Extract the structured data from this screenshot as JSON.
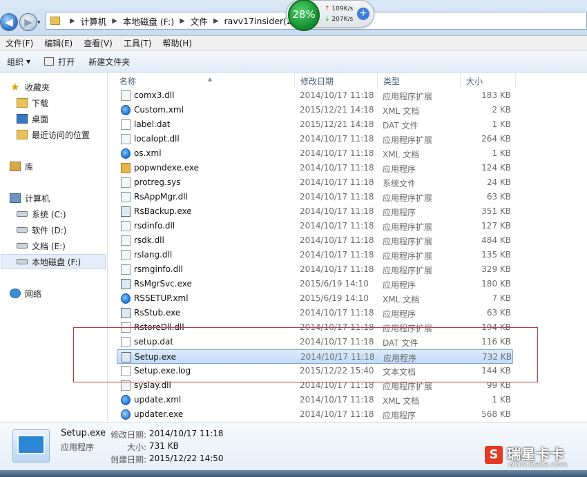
{
  "address_bar": {
    "recent_arrow": "▾",
    "path": [
      "计算机",
      "本地磁盘 (F:)",
      "文件",
      "ravv17insider(2)"
    ]
  },
  "net_widget": {
    "percent": "28%",
    "up": "109K/s",
    "down": "207K/s"
  },
  "menu": [
    "文件(F)",
    "编辑(E)",
    "查看(V)",
    "工具(T)",
    "帮助(H)"
  ],
  "toolbar": {
    "organize": "组织",
    "open": "打开",
    "new_folder": "新建文件夹"
  },
  "sidebar": {
    "favorites": "收藏夹",
    "downloads": "下载",
    "desktop": "桌面",
    "recent_places": "最近访问的位置",
    "libraries": "库",
    "computer": "计算机",
    "drive_c": "系统 (C:)",
    "drive_d": "软件 (D:)",
    "drive_e": "文档 (E:)",
    "drive_f": "本地磁盘 (F:)",
    "network": "网络"
  },
  "columns": {
    "name": "名称",
    "date": "修改日期",
    "type": "类型",
    "size": "大小"
  },
  "files": [
    {
      "name": "comx3.dll",
      "date": "2014/10/17 11:18",
      "type": "应用程序扩展",
      "size": "183 KB",
      "icon": "dll-icon"
    },
    {
      "name": "Custom.xml",
      "date": "2015/12/21 14:18",
      "type": "XML 文档",
      "size": "2 KB",
      "icon": "xml-icon"
    },
    {
      "name": "label.dat",
      "date": "2015/12/21 14:18",
      "type": "DAT 文件",
      "size": "1 KB",
      "icon": "dat-icon"
    },
    {
      "name": "localopt.dll",
      "date": "2014/10/17 11:18",
      "type": "应用程序扩展",
      "size": "264 KB",
      "icon": "dll-icon"
    },
    {
      "name": "os.xml",
      "date": "2014/10/17 11:18",
      "type": "XML 文档",
      "size": "1 KB",
      "icon": "xml-icon"
    },
    {
      "name": "popwndexe.exe",
      "date": "2014/10/17 11:18",
      "type": "应用程序",
      "size": "124 KB",
      "icon": "box-icon"
    },
    {
      "name": "protreg.sys",
      "date": "2014/10/17 11:18",
      "type": "系统文件",
      "size": "24 KB",
      "icon": "dll-icon"
    },
    {
      "name": "RsAppMgr.dll",
      "date": "2014/10/17 11:18",
      "type": "应用程序扩展",
      "size": "63 KB",
      "icon": "dll-icon"
    },
    {
      "name": "RsBackup.exe",
      "date": "2014/10/17 11:18",
      "type": "应用程序",
      "size": "351 KB",
      "icon": "exe-icon"
    },
    {
      "name": "rsdinfo.dll",
      "date": "2014/10/17 11:18",
      "type": "应用程序扩展",
      "size": "127 KB",
      "icon": "dll-icon"
    },
    {
      "name": "rsdk.dll",
      "date": "2014/10/17 11:18",
      "type": "应用程序扩展",
      "size": "484 KB",
      "icon": "dll-icon"
    },
    {
      "name": "rslang.dll",
      "date": "2014/10/17 11:18",
      "type": "应用程序扩展",
      "size": "135 KB",
      "icon": "dll-icon"
    },
    {
      "name": "rsmginfo.dll",
      "date": "2014/10/17 11:18",
      "type": "应用程序扩展",
      "size": "329 KB",
      "icon": "dll-icon"
    },
    {
      "name": "RsMgrSvc.exe",
      "date": "2015/6/19 14:10",
      "type": "应用程序",
      "size": "180 KB",
      "icon": "exe-icon"
    },
    {
      "name": "RSSETUP.xml",
      "date": "2015/6/19 14:10",
      "type": "XML 文档",
      "size": "7 KB",
      "icon": "xml-icon"
    },
    {
      "name": "RsStub.exe",
      "date": "2014/10/17 11:18",
      "type": "应用程序",
      "size": "63 KB",
      "icon": "exe-icon"
    },
    {
      "name": "RstoreDll.dll",
      "date": "2014/10/17 11:18",
      "type": "应用程序扩展",
      "size": "194 KB",
      "icon": "dll-icon"
    },
    {
      "name": "setup.dat",
      "date": "2014/10/17 11:18",
      "type": "DAT 文件",
      "size": "116 KB",
      "icon": "dat-icon"
    },
    {
      "name": "Setup.exe",
      "date": "2014/10/17 11:18",
      "type": "应用程序",
      "size": "732 KB",
      "icon": "exe-icon",
      "selected": true
    },
    {
      "name": "Setup.exe.log",
      "date": "2015/12/22 15:40",
      "type": "文本文档",
      "size": "144 KB",
      "icon": "log-icon"
    },
    {
      "name": "syslay.dll",
      "date": "2014/10/17 11:18",
      "type": "应用程序扩展",
      "size": "99 KB",
      "icon": "dll-icon"
    },
    {
      "name": "update.xml",
      "date": "2014/10/17 11:18",
      "type": "XML 文档",
      "size": "1 KB",
      "icon": "xml-icon"
    },
    {
      "name": "updater.exe",
      "date": "2014/10/17 11:18",
      "type": "应用程序",
      "size": "568 KB",
      "icon": "update-icon"
    }
  ],
  "details": {
    "name": "Setup.exe",
    "type": "应用程序",
    "modified_label": "修改日期:",
    "modified": "2014/10/17 11:18",
    "size_label": "大小:",
    "size": "731 KB",
    "created_label": "创建日期:",
    "created": "2015/12/22 14:50"
  },
  "watermark": {
    "text": "瑞星卡卡",
    "url": "www.ikaka.com"
  }
}
